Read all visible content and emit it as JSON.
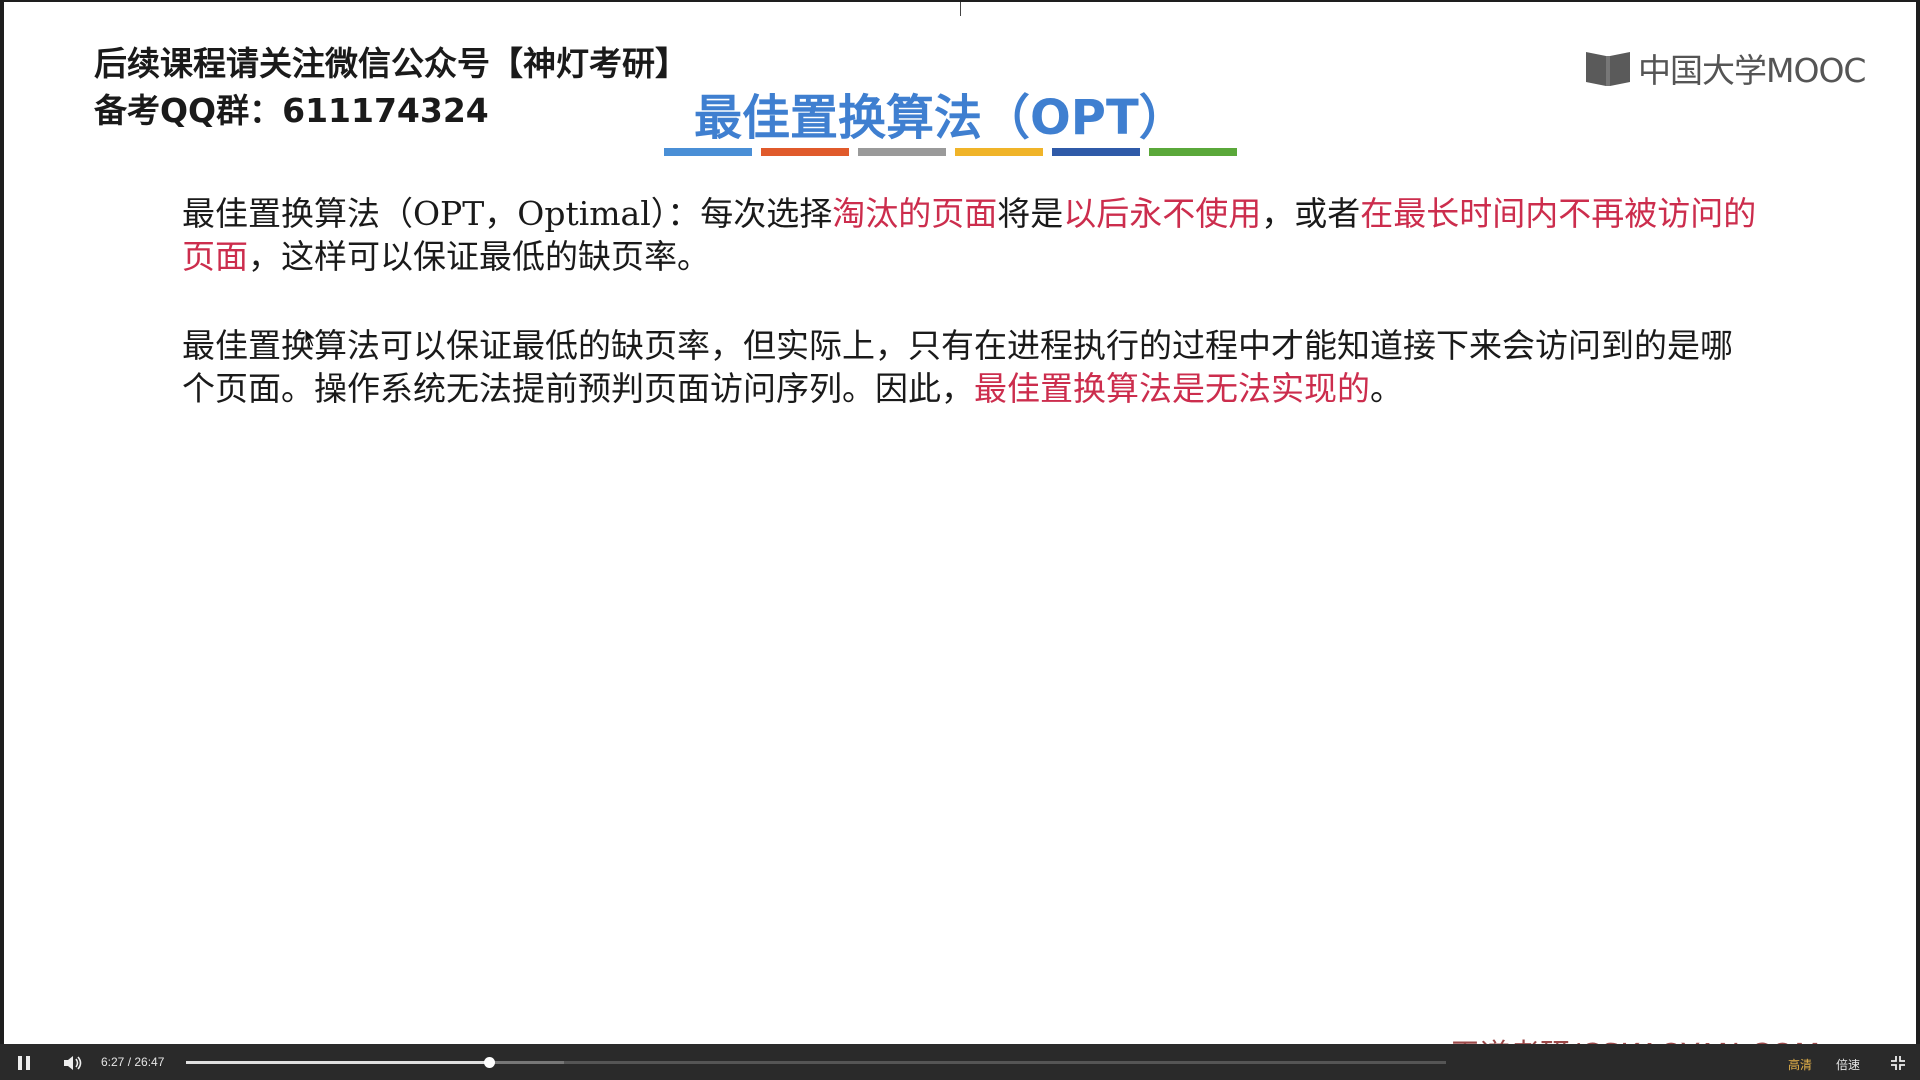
{
  "slide": {
    "notice_line1": "后续课程请关注微信公众号【神灯考研】",
    "notice_line2": "备考QQ群：611174324",
    "logo_text": "中国大学MOOC",
    "title": "最佳置换算法（OPT）",
    "title_color": "#3f7fd0",
    "color_bars": [
      "#4a8fd6",
      "#e05a2b",
      "#9a9a9a",
      "#f0b429",
      "#2f5aa8",
      "#5aa83a"
    ],
    "paragraph1": {
      "t1": "最佳置换算法（OPT，Optimal）：每次选择",
      "r1": "淘汰的页面",
      "t2": "将是",
      "r2": "以后永不使用",
      "t3": "，或者",
      "r3": "在最长时间内不再被访问的页面",
      "t4": "，这样可以保证最低的缺页率。"
    },
    "paragraph2": {
      "t1": "最佳置换算法可以保证最低的缺页率，但实际上，只有在进程执行的过程中才能知道接下来会访问到的是哪个页面。操作系统无法提前预判页面访问序列。因此，",
      "r1": "最佳置换算法是无法实现的",
      "t2": "。"
    },
    "highlight_color": "#cc2d4d",
    "watermark": "王道考研/CSKAOYAN.COM"
  },
  "player": {
    "play_icon": "pause-icon",
    "volume_icon": "volume-icon",
    "time_display": "6:27 / 26:47",
    "played_fraction": 0.2408,
    "buffered_fraction": 0.3,
    "quality_label": "高清",
    "speed_label": "倍速",
    "exit_fullscreen_icon": "exit-fullscreen-icon"
  }
}
